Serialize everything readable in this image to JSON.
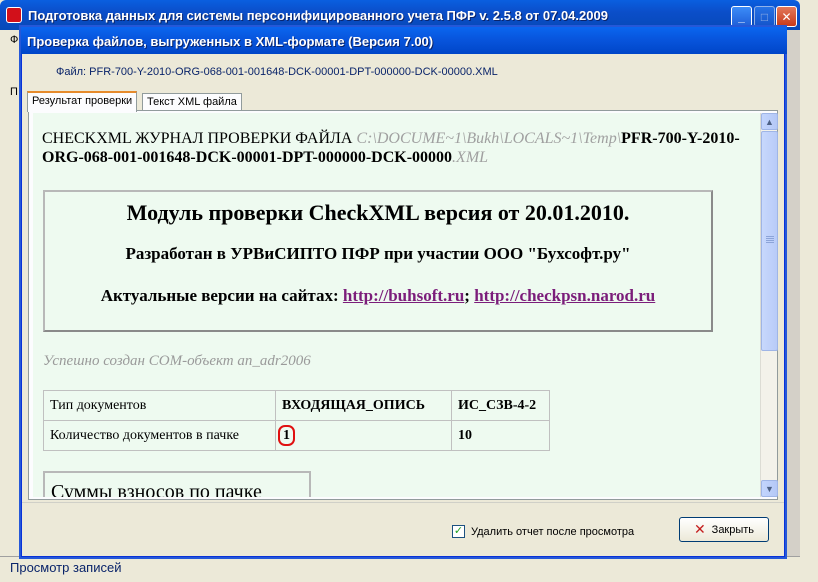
{
  "main_window": {
    "title": "Подготовка данных для системы персонифицированного учета ПФР v. 2.5.8 от 07.04.2009",
    "menu_first_char": "Ф",
    "status_text": "Просмотр записей",
    "left_mark": "П"
  },
  "dialog": {
    "title": "Проверка файлов, выгруженных в XML-формате (Версия 7.00)",
    "file_label": "Файл: PFR-700-Y-2010-ORG-068-001-001648-DCK-00001-DPT-000000-DCK-00000.XML",
    "tabs": [
      "Результат проверки",
      "Текст XML файла"
    ],
    "active_tab": 0,
    "log": {
      "prefix": "CHECKXML ЖУРНАЛ ПРОВЕРКИ ФАЙЛА ",
      "path": "C:\\DOCUME~1\\Bukh\\LOCALS~1\\Temp\\",
      "filename": "PFR-700-Y-2010-ORG-068-001-001648-DCK-00001-DPT-000000-DCK-00000",
      "ext": ".XML"
    },
    "module": {
      "title": "Модуль проверки CheckXML версия от 20.01.2010.",
      "developer": "Разработан в УРВиСИПТО ПФР при участии ООО \"Бухсофт.ру\"",
      "sites_label": "Актуальные версии на сайтах:",
      "site1": "http://buhsoft.ru",
      "sep": ";",
      "site2": "http://checkpsn.narod.ru"
    },
    "com_line": "Успешно создан COM-объект an_adr2006",
    "table": {
      "row1": {
        "label": "Тип документов",
        "col1": "ВХОДЯЩАЯ_ОПИСЬ",
        "col2": "ИС_СЗВ-4-2"
      },
      "row2": {
        "label": "Количество документов в пачке",
        "col1": "1",
        "col2": "10"
      }
    },
    "sums_title": "Суммы взносов по пачке",
    "checkbox_label": "Удалить отчет после просмотра",
    "checkbox_checked": true,
    "close_label": "Закрыть"
  }
}
